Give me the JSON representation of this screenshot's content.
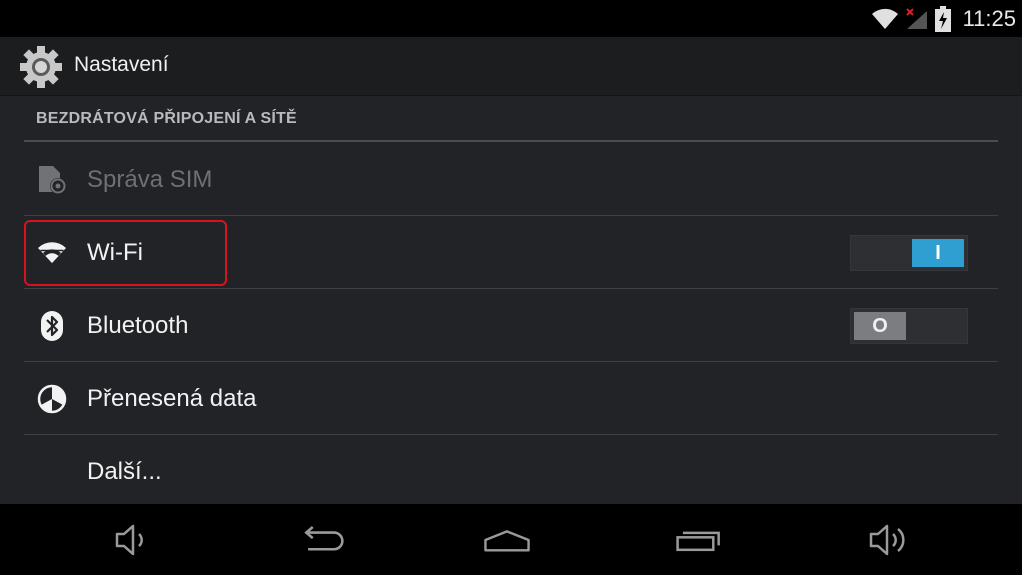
{
  "status_bar": {
    "time": "11:25",
    "icons": [
      "wifi-icon",
      "signal-no-sim-icon",
      "battery-charging-icon"
    ]
  },
  "action_bar": {
    "title": "Nastavení",
    "icon": "settings-gear-icon"
  },
  "section": {
    "header": "BEZDRÁTOVÁ PŘIPOJENÍ A SÍTĚ"
  },
  "items": [
    {
      "label": "Správa SIM",
      "icon": "sim-card-icon",
      "enabled": false
    },
    {
      "label": "Wi-Fi",
      "icon": "wifi-icon",
      "toggle": "on",
      "toggle_glyph": "I",
      "highlighted": true
    },
    {
      "label": "Bluetooth",
      "icon": "bluetooth-icon",
      "toggle": "off",
      "toggle_glyph": "O"
    },
    {
      "label": "Přenesená data",
      "icon": "data-usage-icon"
    },
    {
      "label": "Další...",
      "icon": ""
    }
  ],
  "nav_bar": {
    "buttons": [
      "volume-down-icon",
      "back-icon",
      "home-icon",
      "recent-apps-icon",
      "volume-up-icon"
    ]
  },
  "colors": {
    "accent": "#2e9fd0",
    "highlight_border": "#d9121f",
    "background": "#212326",
    "action_bar": "#1c1d1f"
  }
}
